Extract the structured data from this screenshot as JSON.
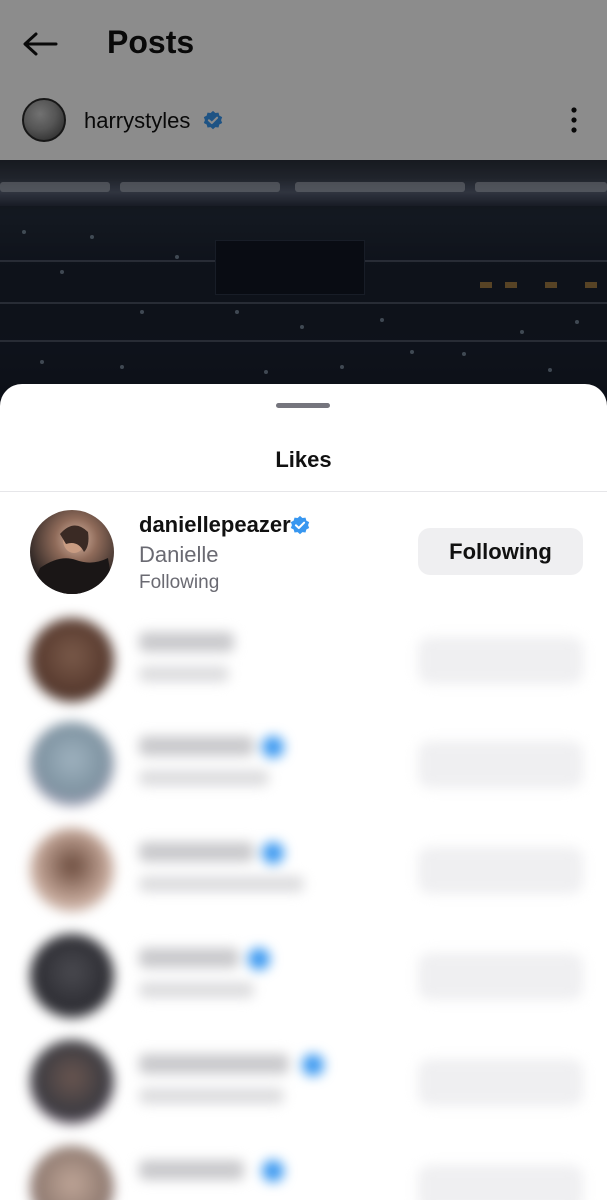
{
  "header": {
    "title": "Posts",
    "back_icon": "arrow-left-icon"
  },
  "post": {
    "author": "harrystyles",
    "author_verified": true,
    "more_icon": "more-vertical-icon"
  },
  "likes_sheet": {
    "title": "Likes",
    "users": [
      {
        "username": "daniellepeazer",
        "verified": true,
        "full_name": "Danielle",
        "subtext": "Following",
        "button_label": "Following",
        "avatar_color": "#5a3f36"
      },
      {
        "username": "",
        "verified": false,
        "full_name": "",
        "subtext": "",
        "button_label": "",
        "avatar_color": "#6d4a3c"
      },
      {
        "username": "",
        "verified": true,
        "full_name": "",
        "subtext": "",
        "button_label": "",
        "avatar_color": "#8a9aa6"
      },
      {
        "username": "",
        "verified": true,
        "full_name": "",
        "subtext": "",
        "button_label": "",
        "avatar_color": "#b79a8c"
      },
      {
        "username": "",
        "verified": true,
        "full_name": "",
        "subtext": "",
        "button_label": "",
        "avatar_color": "#3f3f45"
      },
      {
        "username": "",
        "verified": true,
        "full_name": "",
        "subtext": "",
        "button_label": "",
        "avatar_color": "#5c5350"
      },
      {
        "username": "",
        "verified": true,
        "full_name": "",
        "subtext": "",
        "button_label": "",
        "avatar_color": "#a58e82"
      }
    ]
  },
  "colors": {
    "verified": "#3897f0",
    "button_bg": "#efeff1",
    "secondary_text": "#6a6a72"
  }
}
